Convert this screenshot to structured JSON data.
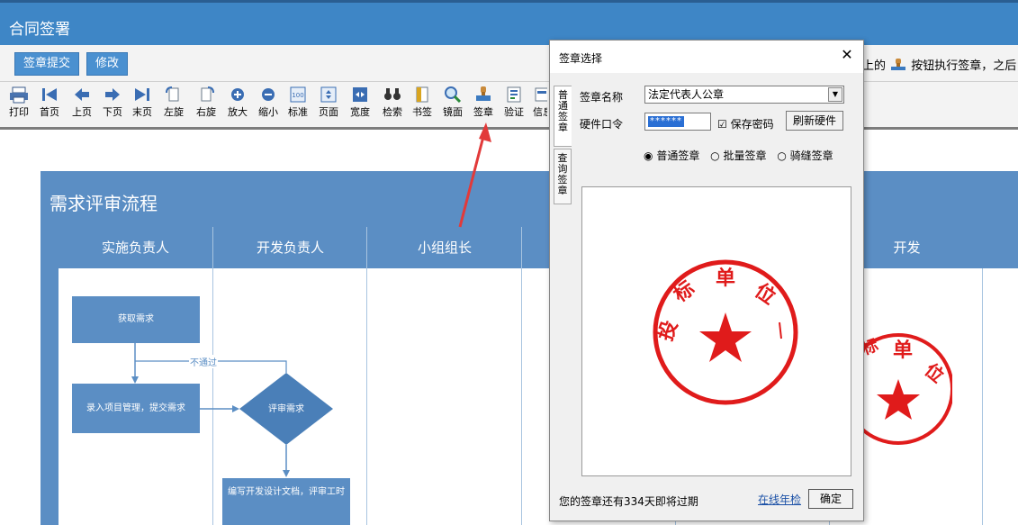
{
  "window": {
    "title": "合同签署"
  },
  "actions": {
    "submit": "签章提交",
    "modify": "修改"
  },
  "hint": {
    "prefix": "上的",
    "suffix": "按钮执行签章，之后"
  },
  "toolbar": {
    "items": [
      {
        "label": "打印",
        "icon": "printer-icon"
      },
      {
        "label": "首页",
        "icon": "first-page-icon"
      },
      {
        "label": "上页",
        "icon": "prev-page-icon"
      },
      {
        "label": "下页",
        "icon": "next-page-icon"
      },
      {
        "label": "末页",
        "icon": "last-page-icon"
      },
      {
        "label": "左旋",
        "icon": "rotate-left-icon"
      },
      {
        "label": "右旋",
        "icon": "rotate-right-icon"
      },
      {
        "label": "放大",
        "icon": "zoom-in-icon"
      },
      {
        "label": "缩小",
        "icon": "zoom-out-icon"
      },
      {
        "label": "标准",
        "icon": "actual-size-icon"
      },
      {
        "label": "页面",
        "icon": "fit-page-icon"
      },
      {
        "label": "宽度",
        "icon": "fit-width-icon"
      },
      {
        "label": "检索",
        "icon": "binoculars-icon"
      },
      {
        "label": "书签",
        "icon": "bookmark-icon"
      },
      {
        "label": "镜面",
        "icon": "magnifier-icon"
      },
      {
        "label": "签章",
        "icon": "seal-stamp-icon"
      },
      {
        "label": "验证",
        "icon": "verify-icon"
      },
      {
        "label": "信息",
        "icon": "info-icon"
      }
    ]
  },
  "flow": {
    "title": "需求评审流程",
    "lanes": [
      "实施负责人",
      "开发负责人",
      "小组组长",
      "",
      "",
      "开发"
    ],
    "nodes": {
      "get_req": "获取需求",
      "enter_req": "录入项目管理，提交需求",
      "review": "评审需求",
      "write_doc": "编写开发设计文档，评审工时",
      "reject": "不通过"
    }
  },
  "dialog": {
    "title": "签章选择",
    "close": "✕",
    "tabs": [
      "普通签章",
      "查询签章"
    ],
    "seal_name_label": "签章名称",
    "seal_name_value": "法定代表人公章",
    "pin_label": "硬件口令",
    "pin_value": "******",
    "save_pwd_label": "保存密码",
    "save_pwd_checked": true,
    "refresh_label": "刷新硬件",
    "modes": [
      {
        "label": "普通签章",
        "selected": true
      },
      {
        "label": "批量签章",
        "selected": false
      },
      {
        "label": "骑缝签章",
        "selected": false
      }
    ],
    "seal_text": "投标单位",
    "expire_text": "您的签章还有334天即将过期",
    "online_check": "在线年检",
    "ok": "确定"
  },
  "colors": {
    "title_bar": "#3e86c6",
    "flow_blue": "#5b8ec4",
    "seal_red": "#e01b1b",
    "arrow_red": "#e23a3a"
  }
}
